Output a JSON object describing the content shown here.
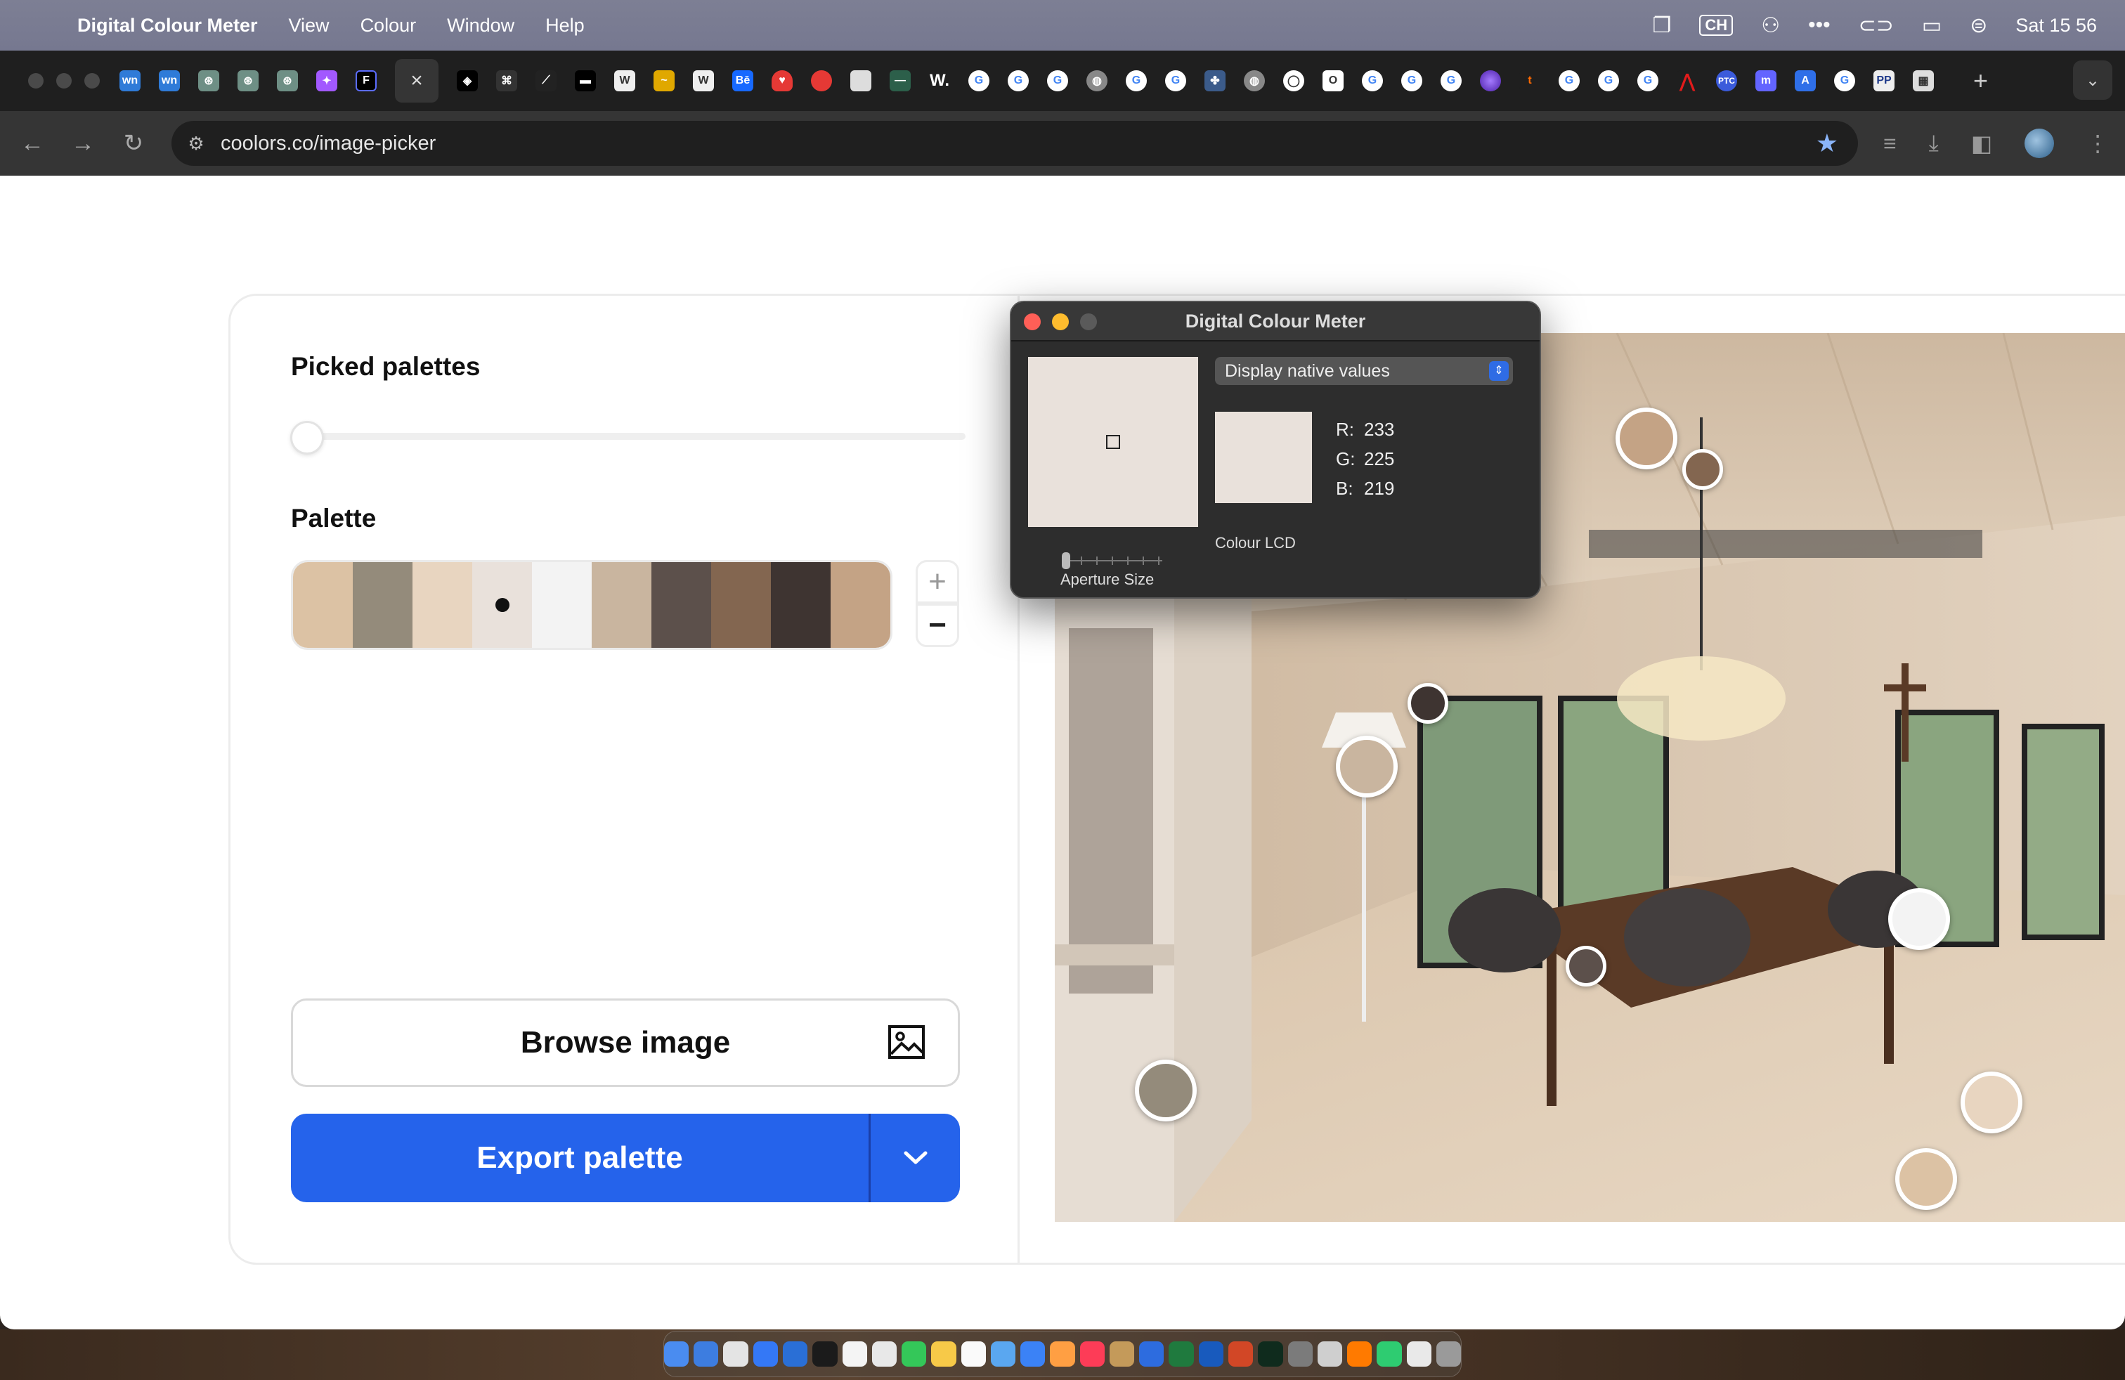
{
  "menubar": {
    "app_name": "Digital Colour Meter",
    "items": [
      "View",
      "Colour",
      "Window",
      "Help"
    ],
    "input_source": "CH",
    "clock": "Sat 15 56"
  },
  "browser": {
    "url": "coolors.co/image-picker",
    "active_tab_close": "×",
    "new_tab": "+"
  },
  "sidebar": {
    "picked_palettes_title": "Picked palettes",
    "palette_title": "Palette",
    "plus_label": "+",
    "minus_label": "−",
    "browse_label": "Browse image",
    "export_label": "Export palette"
  },
  "palette_colors": [
    "#dcc2a4",
    "#948b7b",
    "#e8d5c0",
    "#e9e1db",
    "#f3f3f3",
    "#c9b59f",
    "#5c504b",
    "#836650",
    "#3e3431",
    "#c4a385"
  ],
  "palette_selected_index": 3,
  "colour_meter": {
    "title": "Digital Colour Meter",
    "mode": "Display native values",
    "r_label": "R:",
    "r": "233",
    "g_label": "G:",
    "g": "225",
    "b_label": "B:",
    "b": "219",
    "display": "Colour LCD",
    "aperture_label": "Aperture Size",
    "sample_color": "#e9e1db"
  },
  "colors": {
    "accent": "#2563eb",
    "close": "#ff5f57",
    "minimize": "#febc2e",
    "zoom": "#5a5a5a"
  }
}
